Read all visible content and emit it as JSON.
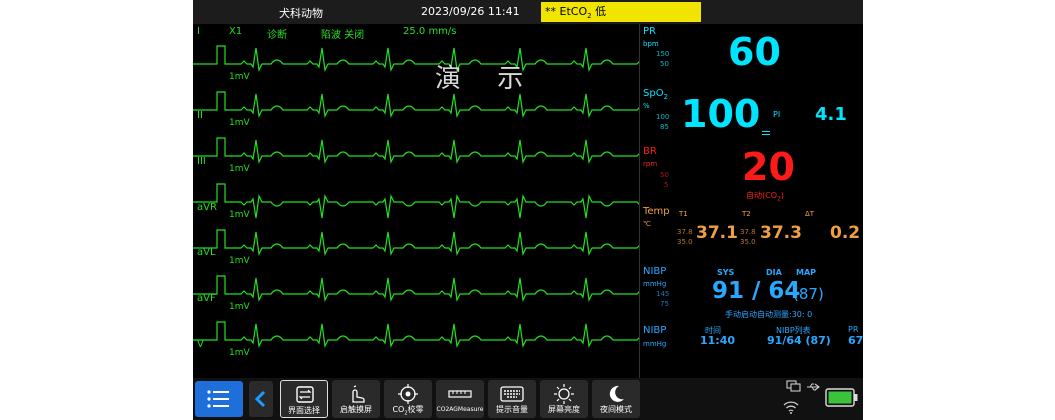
{
  "topbar": {
    "patient_type": "犬科动物",
    "datetime": "2023/09/26 11:41",
    "alarm_prefix": "** EtCO",
    "alarm_sub": "2",
    "alarm_suffix": " 低",
    "alarm_color": "#f0e400"
  },
  "ecg": {
    "header": {
      "lead": "I",
      "gain": "X1",
      "mode": "诊断",
      "filter": "陷波 关闭",
      "speed": "25.0 mm/s"
    },
    "leads": [
      "I",
      "II",
      "III",
      "aVR",
      "aVL",
      "aVF",
      "V"
    ],
    "scale_label": "1mV",
    "demo_text": "演 示",
    "color": "#22e022"
  },
  "params": {
    "pr": {
      "label": "PR",
      "unit": "bpm",
      "hi": "150",
      "lo": "50",
      "value": "60",
      "color": "#00e5ff"
    },
    "spo2": {
      "label": "SpO",
      "sub": "2",
      "unit": "%",
      "hi": "100",
      "lo": "85",
      "value": "100",
      "pi_label": "PI",
      "pi_value": "4.1",
      "color": "#00e5ff"
    },
    "br": {
      "label": "BR",
      "unit": "rpm",
      "hi": "50",
      "lo": "5",
      "value": "20",
      "source_prefix": "自动(CO",
      "source_sub": "2",
      "source_suffix": ")",
      "color": "#ff1a1a"
    },
    "temp": {
      "label": "Temp",
      "unit": "℃",
      "t1_label": "T1",
      "t2_label": "T2",
      "dt_label": "ΔT",
      "t1_hi": "37.8",
      "t1_lo": "35.0",
      "t1_value": "37.1",
      "t2_hi": "37.8",
      "t2_lo": "35.0",
      "t2_value": "37.3",
      "dt_value": "0.2",
      "color": "#f0a040"
    },
    "nibp": {
      "label": "NIBP",
      "unit": "mmHg",
      "hi": "145",
      "lo": "75",
      "sys_label": "SYS",
      "dia_label": "DIA",
      "map_label": "MAP",
      "value": "91 / 64",
      "map_value": "(87)",
      "status": "手动启动自动测量:30: 0",
      "color": "#29a8ff"
    },
    "nibp_list": {
      "label": "NIBP",
      "unit": "mmHg",
      "time_label": "时间",
      "list_label": "NIBP列表",
      "pr_label": "PR",
      "time": "11:40",
      "reading": "91/64 (87)",
      "pr": "67",
      "color": "#29a8ff"
    }
  },
  "bottom": {
    "buttons": [
      {
        "label": "界面选择",
        "icon": "layout-switch-icon"
      },
      {
        "label": "启触摸屏",
        "icon": "touch-hand-icon"
      },
      {
        "label_prefix": "CO",
        "label_sub": "2",
        "label_suffix": "校零",
        "icon": "target-icon"
      },
      {
        "label": "CO2AGMeasure",
        "icon": "ruler-icon"
      },
      {
        "label": "提示音量",
        "icon": "keyboard-icon"
      },
      {
        "label": "屏幕亮度",
        "icon": "brightness-icon"
      },
      {
        "label": "夜间模式",
        "icon": "moon-icon"
      }
    ],
    "battery_color": "#3cc33c"
  }
}
